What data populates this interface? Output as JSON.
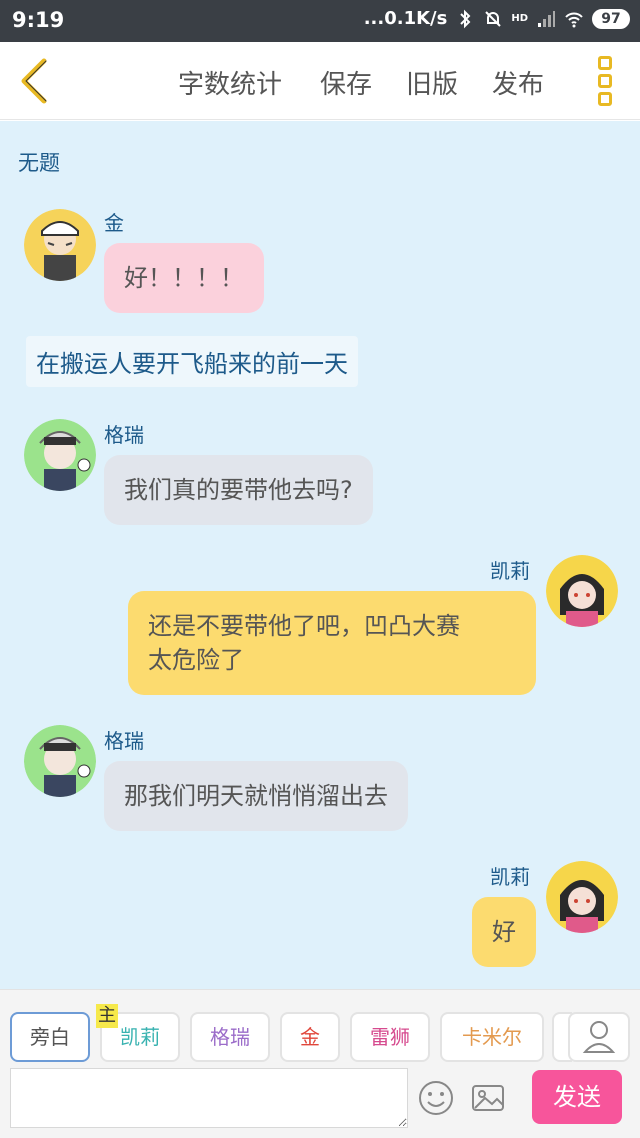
{
  "status_bar": {
    "time": "9:19",
    "network_speed": "...0.1K/s",
    "signal_label": "HD",
    "battery": "97"
  },
  "header": {
    "back_icon": "chevron-left-icon",
    "actions": [
      "字数统计",
      "保存",
      "旧版",
      "发布"
    ],
    "more_icon": "more-vertical-icon",
    "accent_color": "#e8b923"
  },
  "chat": {
    "title": "无题",
    "narration": "在搬运人要开飞船来的前一天",
    "messages": [
      {
        "speaker": "金",
        "text": "好！！！！",
        "side": "left",
        "color": "pink"
      },
      {
        "speaker": "格瑞",
        "text": "我们真的要带他去吗?",
        "side": "left",
        "color": "grey"
      },
      {
        "speaker": "凯莉",
        "text_line1": "还是不要带他了吧，凹凸大赛",
        "text_line2": "太危险了",
        "side": "right",
        "color": "yellow"
      },
      {
        "speaker": "格瑞",
        "text": "那我们明天就悄悄溜出去",
        "side": "left",
        "color": "grey"
      },
      {
        "speaker": "凯莉",
        "text": "好",
        "side": "right",
        "color": "yellow"
      }
    ]
  },
  "bottom_bar": {
    "roles": [
      {
        "label": "旁白",
        "color": "#555555"
      },
      {
        "label": "凯莉",
        "color": "#38b2b0"
      },
      {
        "label": "格瑞",
        "color": "#9b6cc9"
      },
      {
        "label": "金",
        "color": "#e0463a"
      },
      {
        "label": "雷狮",
        "color": "#d64a8e"
      },
      {
        "label": "卡米尔",
        "color": "#e39a4f"
      }
    ],
    "host_tag": "主",
    "input_placeholder": "",
    "emoji_icon": "smiley-icon",
    "image_icon": "image-icon",
    "user_icon": "user-icon",
    "send_label": "发送",
    "send_color": "#f7559b"
  }
}
